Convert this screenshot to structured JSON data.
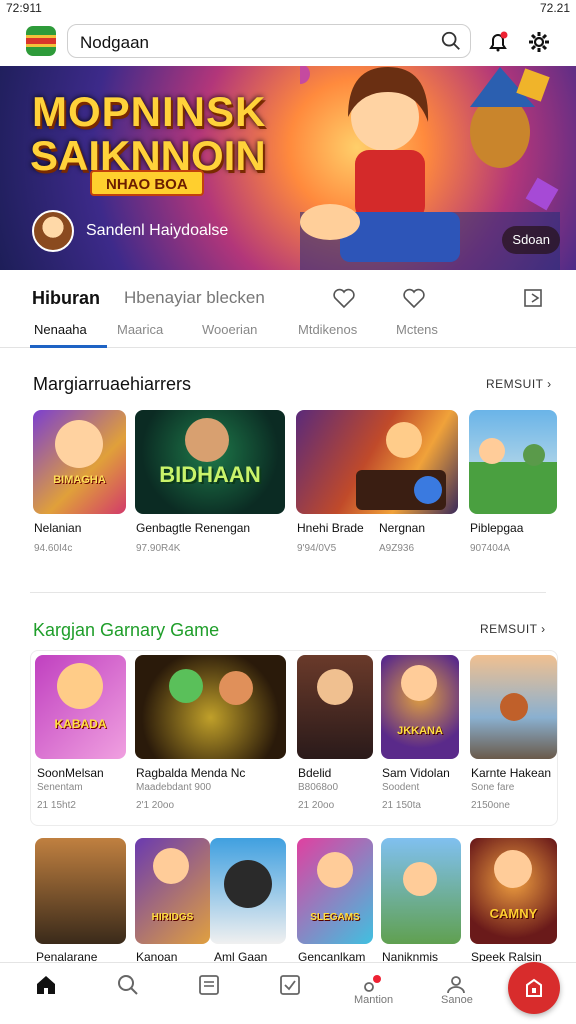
{
  "status": {
    "time": "72:911",
    "right": "72.21"
  },
  "search": {
    "value": "Nodgaan"
  },
  "banner": {
    "title1": "MOPNINSK",
    "title2": "SAIKNNOIN",
    "tag": "NHAO BOA",
    "subtitle": "Sandenl Haiydoalse",
    "pill": "Sdoan"
  },
  "section_tabs": {
    "main": "Hiburan",
    "sub": "Hbenayiar blecken"
  },
  "tabs": [
    {
      "label": "Nenaaha",
      "active": true
    },
    {
      "label": "Maarica",
      "active": false
    },
    {
      "label": "Wooerian",
      "active": false
    },
    {
      "label": "Mtdikenos",
      "active": false
    },
    {
      "label": "Mctens",
      "active": false
    }
  ],
  "section1": {
    "title": "Margiarruaehiarrers",
    "see_all": "REMSUIT",
    "cards": [
      {
        "title": "Nelanian",
        "meta": "94.60I4c",
        "art": "BIMAGHA"
      },
      {
        "title": "Genbagtle Renengan",
        "meta": "97.90R4K",
        "art": "BIDHAAN"
      },
      {
        "title": "Hnehi Brade",
        "meta": "9'94/0V5",
        "art": ""
      },
      {
        "title": "Nergnan",
        "meta": "A9Z936",
        "art": ""
      },
      {
        "title": "Piblepgaa",
        "meta": "907404A",
        "art": ""
      }
    ]
  },
  "section2": {
    "title": "Kargjan Garnary Game",
    "see_all": "REMSUIT",
    "row1": [
      {
        "title": "SoonMelsan",
        "meta1": "Senentam",
        "meta2": "21 15ht2",
        "art": "KABADA"
      },
      {
        "title": "Ragbalda Menda Nc",
        "meta1": "Maadebdant 900",
        "meta2": "2'1 20oo",
        "art": ""
      },
      {
        "title": "Bdelid",
        "meta1": "B8068o0",
        "meta2": "21 20oo",
        "art": ""
      },
      {
        "title": "Sam Vidolan",
        "meta1": "Soodent",
        "meta2": "21 150ta",
        "art": "JKKANA"
      },
      {
        "title": "Karnte Hakean",
        "meta1": "Sone fare",
        "meta2": "2150one",
        "art": ""
      }
    ],
    "row2": [
      {
        "title": "Penalarane",
        "art": ""
      },
      {
        "title": "Kanoan",
        "art": "HIRIDGS"
      },
      {
        "title": "Aml Gaan",
        "art": ""
      },
      {
        "title": "Gencanlkam",
        "art": "SLEGAMS"
      },
      {
        "title": "Naniknmis",
        "art": ""
      },
      {
        "title": "Speek Ralsin",
        "art": "CAMNY"
      }
    ]
  },
  "nav": {
    "items": [
      {
        "name": "home",
        "label": ""
      },
      {
        "name": "search",
        "label": ""
      },
      {
        "name": "list",
        "label": ""
      },
      {
        "name": "check",
        "label": ""
      },
      {
        "name": "mentions",
        "label": "Mantion"
      },
      {
        "name": "profile",
        "label": "Sanoe"
      }
    ]
  },
  "colors": {
    "accent": "#1e63c4",
    "section2_title": "#1f9e2a",
    "fab": "#d82c2c"
  }
}
